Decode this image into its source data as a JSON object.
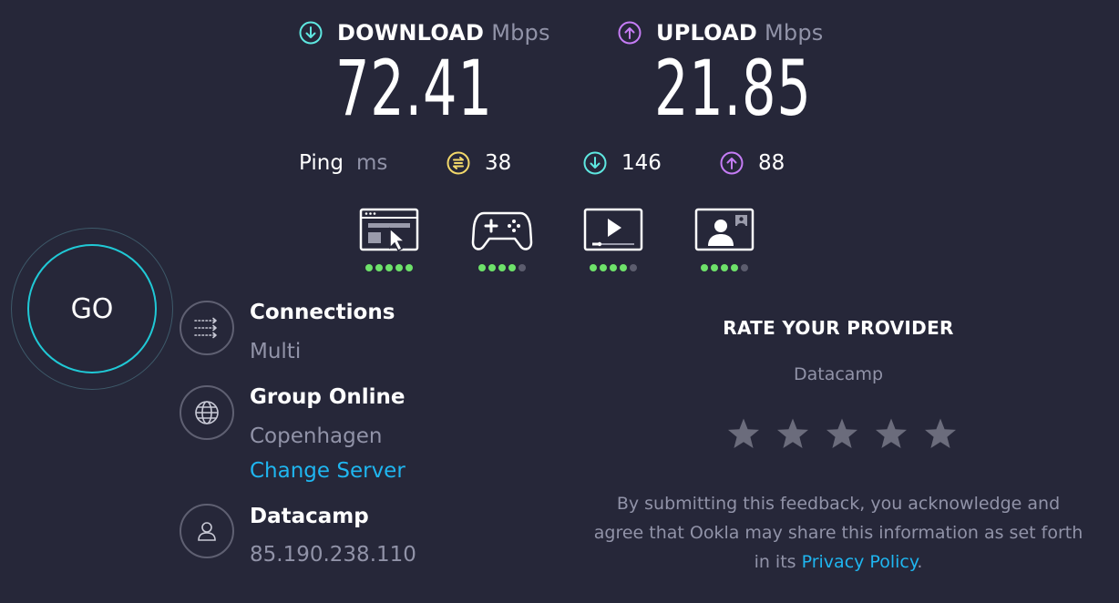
{
  "download": {
    "label": "DOWNLOAD",
    "unit": "Mbps",
    "value": "72.41",
    "icon": "download-arrow-icon",
    "color": "#5ee7e0"
  },
  "upload": {
    "label": "UPLOAD",
    "unit": "Mbps",
    "value": "21.85",
    "icon": "upload-arrow-icon",
    "color": "#c57cf5"
  },
  "ping": {
    "label": "Ping",
    "unit": "ms",
    "idle": {
      "value": "38",
      "icon": "idle-latency-icon",
      "color": "#f2d86a"
    },
    "download": {
      "value": "146",
      "icon": "download-latency-icon",
      "color": "#5ee7e0"
    },
    "upload": {
      "value": "88",
      "icon": "upload-latency-icon",
      "color": "#c57cf5"
    }
  },
  "activities": [
    {
      "icon": "web-browsing-icon",
      "rating": 5,
      "max": 5
    },
    {
      "icon": "gaming-controller-icon",
      "rating": 4,
      "max": 5
    },
    {
      "icon": "video-streaming-icon",
      "rating": 4,
      "max": 5
    },
    {
      "icon": "video-call-icon",
      "rating": 4,
      "max": 5
    }
  ],
  "go_button": {
    "label": "GO"
  },
  "connections": {
    "title": "Connections",
    "value": "Multi",
    "icon": "connections-icon"
  },
  "server": {
    "title": "Group Online",
    "location": "Copenhagen",
    "change_label": "Change Server",
    "icon": "globe-icon"
  },
  "provider": {
    "title": "Datacamp",
    "ip": "85.190.238.110",
    "icon": "user-icon"
  },
  "rating": {
    "title": "RATE YOUR PROVIDER",
    "provider_name": "Datacamp",
    "stars": 5,
    "disclaimer_text": "By submitting this feedback, you acknowledge and agree that Ookla may share this information as set forth in its ",
    "privacy_link": "Privacy Policy",
    "disclaimer_end": "."
  },
  "colors": {
    "background": "#262739",
    "accent_cyan": "#20c9d6",
    "link_blue": "#1fb6f0",
    "rating_green": "#6ee26a",
    "muted_text": "#9193a8"
  }
}
